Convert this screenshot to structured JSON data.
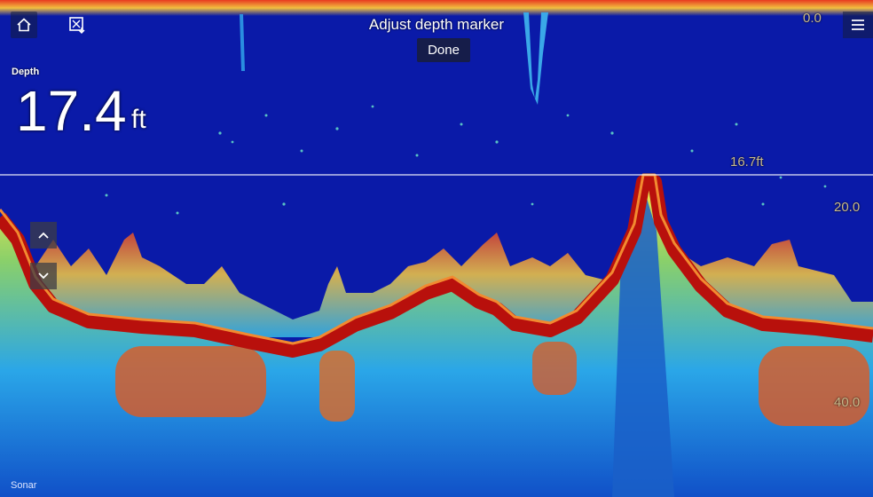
{
  "header": {
    "title": "Adjust depth marker",
    "done_label": "Done",
    "top_scale": "0.0"
  },
  "depth": {
    "label": "Depth",
    "value": "17.4",
    "unit": "ft"
  },
  "marker": {
    "label": "16.7ft"
  },
  "scale": {
    "mid": "20.0",
    "low": "40.0"
  },
  "footer": {
    "mode": "Sonar"
  },
  "icons": {
    "home": "home-icon",
    "waypoint": "waypoint-icon",
    "menu": "menu-icon",
    "up": "chevron-up-icon",
    "down": "chevron-down-icon"
  },
  "colors": {
    "water": "#0a1aa8",
    "bottom": "#c01010",
    "marker_line": "#ffffff",
    "scale_text": "#c9b98a"
  }
}
